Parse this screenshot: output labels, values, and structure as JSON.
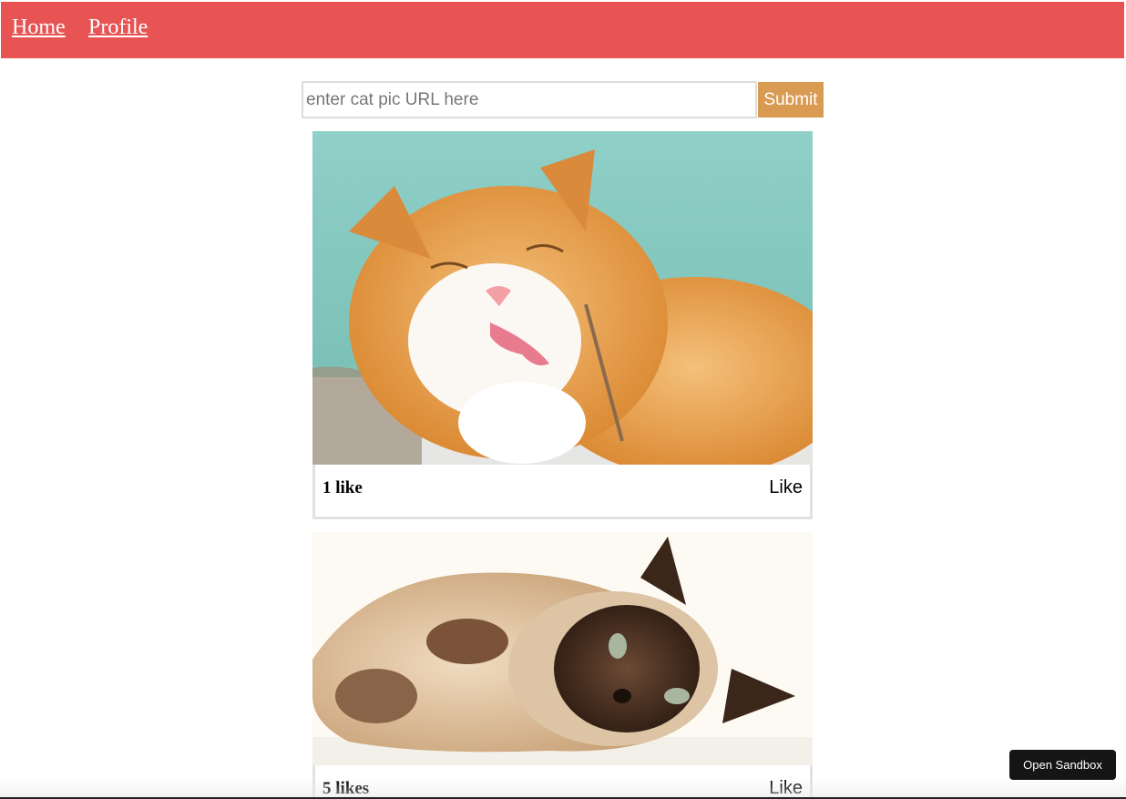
{
  "nav": {
    "home_label": "Home",
    "profile_label": "Profile",
    "bar_color": "#e85454"
  },
  "form": {
    "placeholder": "enter cat pic URL here",
    "value": "",
    "submit_label": "Submit",
    "submit_color": "#d99a52"
  },
  "posts": [
    {
      "image_alt": "ginger and white cat licking its paw",
      "likes_label": "1 like",
      "like_button_label": "Like"
    },
    {
      "image_alt": "siamese cat lying on its side",
      "likes_label": "5 likes",
      "like_button_label": "Like"
    }
  ],
  "sandbox": {
    "button_label": "Open Sandbox"
  }
}
